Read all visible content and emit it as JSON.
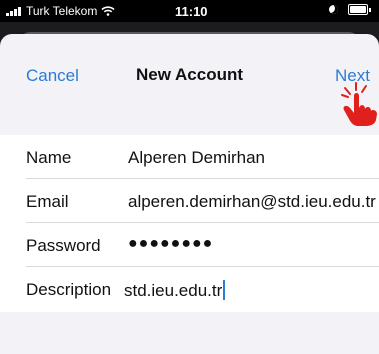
{
  "status_bar": {
    "carrier": "Turk Telekom",
    "time": "11:10"
  },
  "nav": {
    "cancel_label": "Cancel",
    "title": "New Account",
    "next_label": "Next"
  },
  "form": {
    "rows": [
      {
        "label": "Name",
        "value": "Alperen Demirhan"
      },
      {
        "label": "Email",
        "value": "alperen.demirhan@std.ieu.edu.tr"
      },
      {
        "label": "Password",
        "value": "●●●●●●●●"
      },
      {
        "label": "Description",
        "value": "std.ieu.edu.tr"
      }
    ]
  },
  "colors": {
    "accent": "#2d7bd3",
    "pointer_hand": "#e0201c"
  }
}
